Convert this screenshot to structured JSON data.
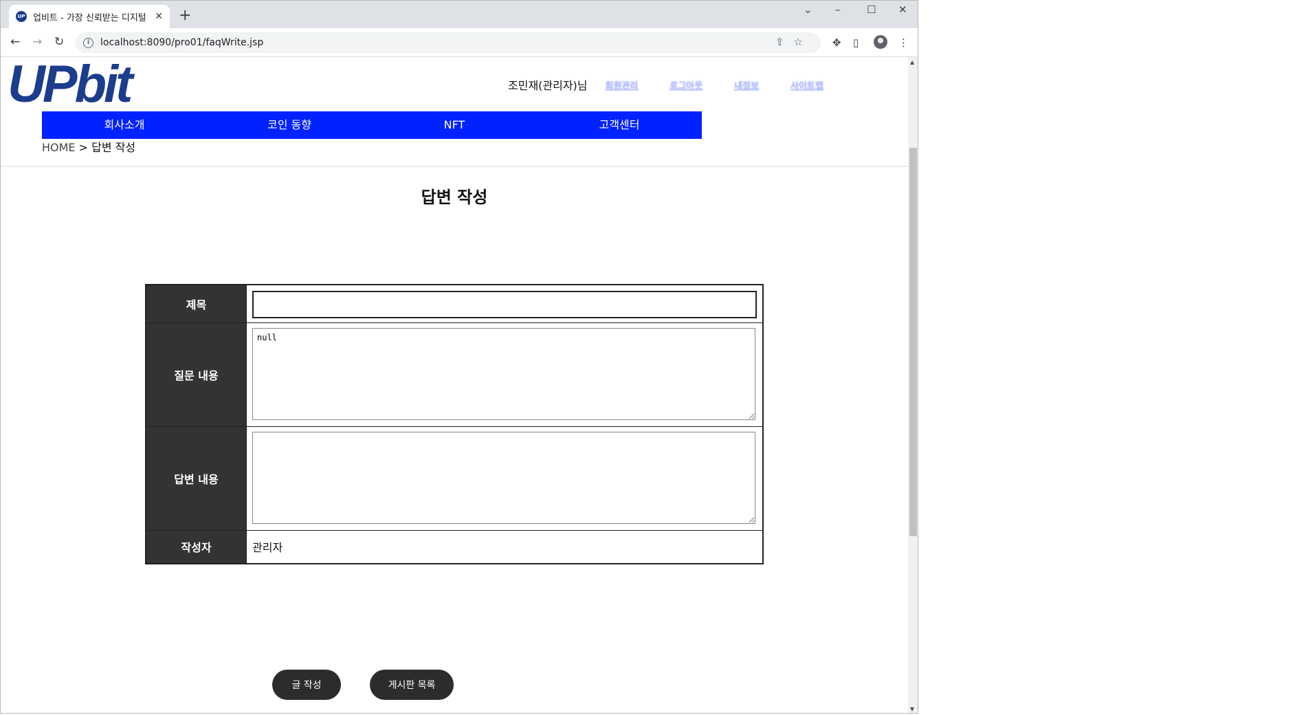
{
  "browser": {
    "tab_title": "업비트 - 가장 신뢰받는 디지털",
    "favicon_text": "UP",
    "url": "localhost:8090/pro01/faqWrite.jsp"
  },
  "header": {
    "logo_text": "UPbit",
    "user_name": "조민재(관리자)님",
    "user_links": [
      "회원관리",
      "로그아웃",
      "내정보",
      "사이트맵"
    ]
  },
  "nav": {
    "items": [
      "회사소개",
      "코인 동향",
      "NFT",
      "고객센터"
    ]
  },
  "breadcrumb": {
    "home": "HOME",
    "separator": ">",
    "current": "답변 작성"
  },
  "page_title": "답변 작성",
  "form": {
    "title_label": "제목",
    "title_value": "",
    "question_label": "질문 내용",
    "question_value": "null",
    "answer_label": "답변 내용",
    "answer_value": "",
    "writer_label": "작성자",
    "writer_value": "관리자"
  },
  "buttons": {
    "submit": "글 작성",
    "list": "게시판 목록"
  },
  "colors": {
    "nav_bg": "#0022ff",
    "logo": "#1c3c8c",
    "label_bg": "#333333",
    "button_bg": "#2c2c2c"
  }
}
